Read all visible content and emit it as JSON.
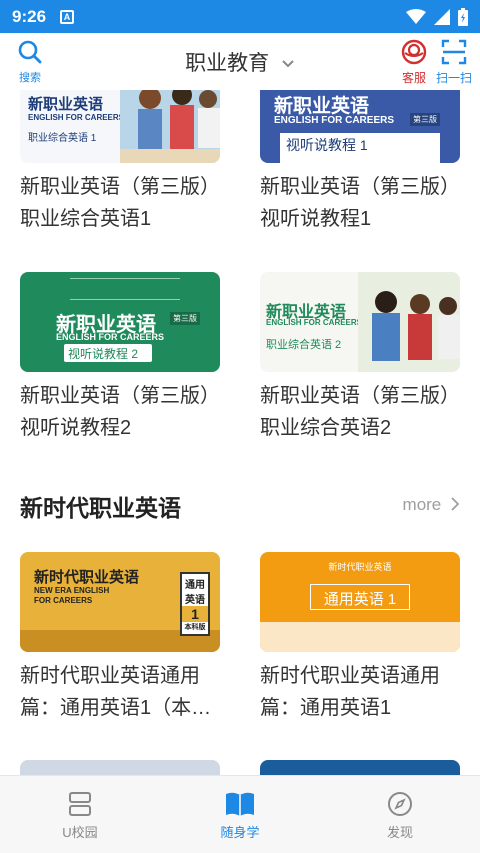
{
  "status": {
    "time": "9:26",
    "a_label": "A"
  },
  "header": {
    "search_label": "搜索",
    "title": "职业教育",
    "service_label": "客服",
    "scan_label": "扫一扫"
  },
  "books_top": [
    {
      "title": "新职业英语（第三版）职业综合英语1",
      "cover_title": "新职业英语",
      "cover_sub": "ENGLISH FOR CAREERS",
      "cover_course": "职业综合英语 1"
    },
    {
      "title": "新职业英语（第三版）视听说教程1",
      "cover_title": "新职业英语",
      "cover_sub": "ENGLISH FOR CAREERS",
      "cover_course": "视听说教程 1",
      "cover_edition": "第三版"
    },
    {
      "title": "新职业英语（第三版）视听说教程2",
      "cover_title": "新职业英语",
      "cover_sub": "ENGLISH FOR CAREERS",
      "cover_course": "视听说教程 2",
      "cover_edition": "第三版"
    },
    {
      "title": "新职业英语（第三版）职业综合英语2",
      "cover_title": "新职业英语",
      "cover_sub": "ENGLISH FOR CAREERS",
      "cover_course": "职业综合英语 2",
      "cover_edition": "第三版"
    }
  ],
  "section": {
    "title": "新时代职业英语",
    "more": "more"
  },
  "books_new": [
    {
      "title": "新时代职业英语通用篇：通用英语1（本…",
      "cover_title": "新时代职业英语",
      "cover_sub1": "NEW ERA ENGLISH",
      "cover_sub2": "FOR CAREERS",
      "cover_tag1": "通用",
      "cover_tag2": "英语",
      "cover_tag3": "1",
      "cover_tag4": "本科版"
    },
    {
      "title": "新时代职业英语通用篇：通用英语1",
      "cover_title": "新时代职业英语",
      "cover_course": "通用英语 1"
    }
  ],
  "nav": [
    {
      "label": "U校园",
      "icon": "u-campus-icon"
    },
    {
      "label": "随身学",
      "icon": "book-icon"
    },
    {
      "label": "发现",
      "icon": "compass-icon"
    }
  ],
  "colors": {
    "accent": "#1e88e5",
    "service_red": "#d32f2f",
    "green_cover": "#1f8a5b",
    "blue_cover": "#3a5aa8",
    "yellow_cover": "#e8b23a",
    "orange_cover": "#f39c12"
  }
}
